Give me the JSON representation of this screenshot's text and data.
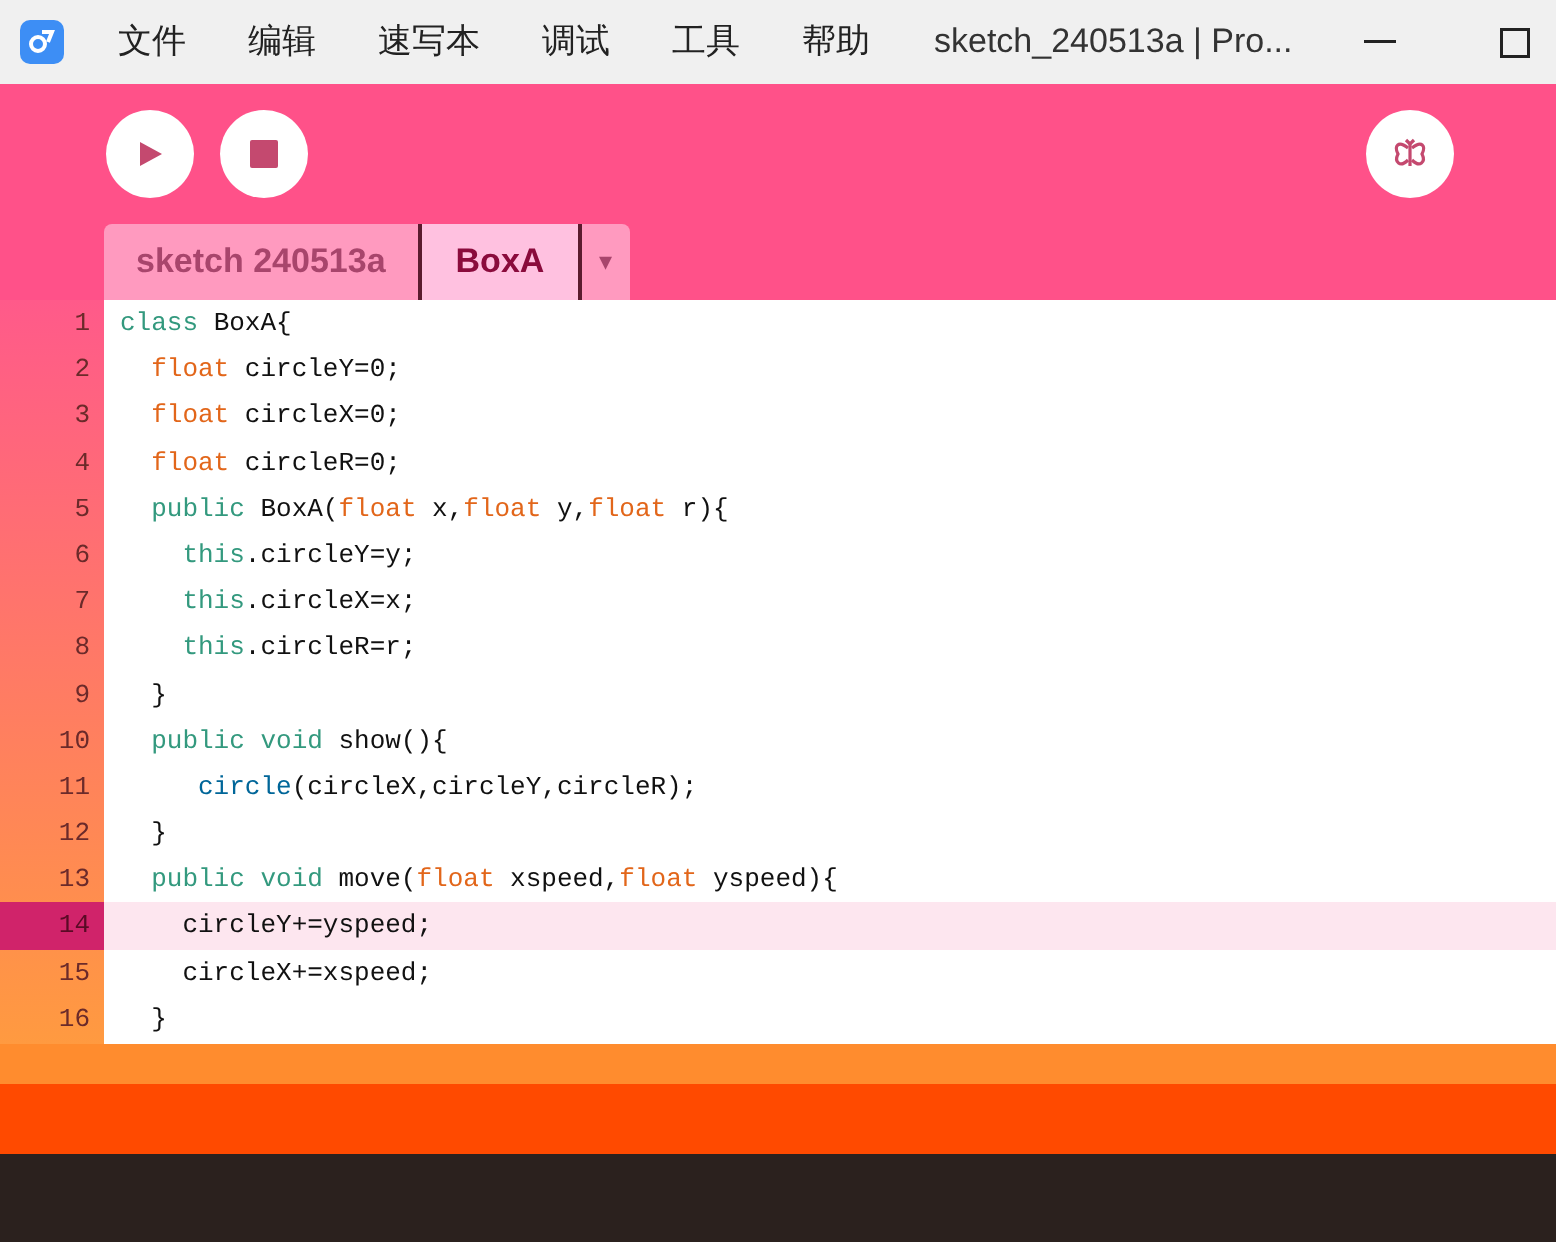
{
  "menu": [
    "文件",
    "编辑",
    "速写本",
    "调试",
    "工具",
    "帮助"
  ],
  "window": {
    "title": "sketch_240513a | Pro..."
  },
  "tabs": [
    {
      "label": "sketch 240513a",
      "selected": false
    },
    {
      "label": "BoxA",
      "selected": true
    }
  ],
  "tab_menu": "▾",
  "lines": [
    {
      "number": "1",
      "highlighted": false,
      "tokens": [
        {
          "kind": "keyword",
          "text": "class"
        },
        {
          "kind": "plain",
          "text": " BoxA{"
        }
      ]
    },
    {
      "number": "2",
      "highlighted": false,
      "tokens": [
        {
          "kind": "type",
          "text": "  float"
        },
        {
          "kind": "plain",
          "text": " circleY=0;"
        }
      ]
    },
    {
      "number": "3",
      "highlighted": false,
      "tokens": [
        {
          "kind": "type",
          "text": "  float"
        },
        {
          "kind": "plain",
          "text": " circleX=0;"
        }
      ]
    },
    {
      "number": "4",
      "highlighted": false,
      "tokens": [
        {
          "kind": "type",
          "text": "  float"
        },
        {
          "kind": "plain",
          "text": " circleR=0;"
        }
      ]
    },
    {
      "number": "5",
      "highlighted": false,
      "tokens": [
        {
          "kind": "keyword",
          "text": "  public"
        },
        {
          "kind": "plain",
          "text": " BoxA("
        },
        {
          "kind": "type",
          "text": "float"
        },
        {
          "kind": "plain",
          "text": " x,"
        },
        {
          "kind": "type",
          "text": "float"
        },
        {
          "kind": "plain",
          "text": " y,"
        },
        {
          "kind": "type",
          "text": "float"
        },
        {
          "kind": "plain",
          "text": " r){"
        }
      ]
    },
    {
      "number": "6",
      "highlighted": false,
      "tokens": [
        {
          "kind": "keyword",
          "text": "    this"
        },
        {
          "kind": "plain",
          "text": ".circleY=y;"
        }
      ]
    },
    {
      "number": "7",
      "highlighted": false,
      "tokens": [
        {
          "kind": "keyword",
          "text": "    this"
        },
        {
          "kind": "plain",
          "text": ".circleX=x;"
        }
      ]
    },
    {
      "number": "8",
      "highlighted": false,
      "tokens": [
        {
          "kind": "keyword",
          "text": "    this"
        },
        {
          "kind": "plain",
          "text": ".circleR=r;"
        }
      ]
    },
    {
      "number": "9",
      "highlighted": false,
      "tokens": [
        {
          "kind": "plain",
          "text": "  }"
        }
      ]
    },
    {
      "number": "10",
      "highlighted": false,
      "tokens": [
        {
          "kind": "keyword",
          "text": "  public void"
        },
        {
          "kind": "plain",
          "text": " show(){"
        }
      ]
    },
    {
      "number": "11",
      "highlighted": false,
      "tokens": [
        {
          "kind": "function",
          "text": "     circle"
        },
        {
          "kind": "plain",
          "text": "(circleX,circleY,circleR);"
        }
      ]
    },
    {
      "number": "12",
      "highlighted": false,
      "tokens": [
        {
          "kind": "plain",
          "text": "  }"
        }
      ]
    },
    {
      "number": "13",
      "highlighted": false,
      "tokens": [
        {
          "kind": "keyword",
          "text": "  public void"
        },
        {
          "kind": "plain",
          "text": " move("
        },
        {
          "kind": "type",
          "text": "float"
        },
        {
          "kind": "plain",
          "text": " xspeed,"
        },
        {
          "kind": "type",
          "text": "float"
        },
        {
          "kind": "plain",
          "text": " yspeed){"
        }
      ]
    },
    {
      "number": "14",
      "highlighted": true,
      "tokens": [
        {
          "kind": "plain",
          "text": "    circleY+=yspeed;"
        }
      ]
    },
    {
      "number": "15",
      "highlighted": false,
      "tokens": [
        {
          "kind": "plain",
          "text": "    circleX+=xspeed;"
        }
      ]
    },
    {
      "number": "16",
      "highlighted": false,
      "tokens": [
        {
          "kind": "plain",
          "text": "  }"
        }
      ]
    }
  ]
}
